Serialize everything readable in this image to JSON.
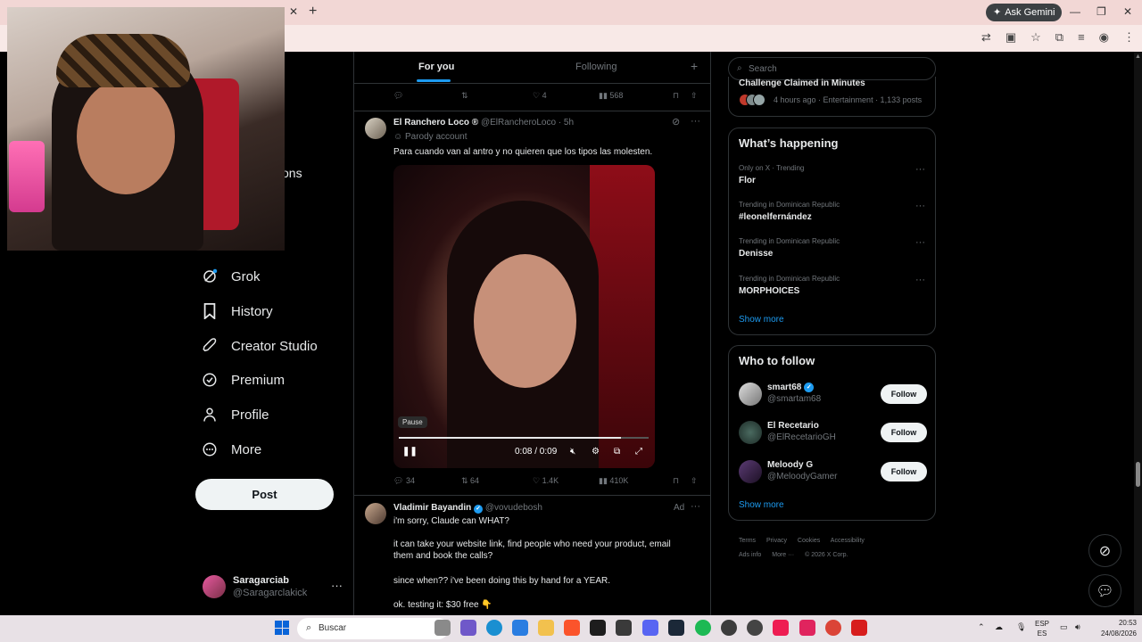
{
  "browser": {
    "ask_gemini": "Ask Gemini"
  },
  "nav": {
    "clipped_label": "ons",
    "items": [
      {
        "label": "Grok",
        "icon": "grok-icon"
      },
      {
        "label": "History",
        "icon": "bookmark-icon"
      },
      {
        "label": "Creator Studio",
        "icon": "rocket-icon"
      },
      {
        "label": "Premium",
        "icon": "verified-badge-icon"
      },
      {
        "label": "Profile",
        "icon": "person-icon"
      },
      {
        "label": "More",
        "icon": "more-circle-icon"
      }
    ],
    "post_label": "Post",
    "account": {
      "name": "Saragarciab",
      "handle": "@Saragarclakick"
    }
  },
  "timeline": {
    "tabs": [
      {
        "label": "For you",
        "active": true
      },
      {
        "label": "Following",
        "active": false
      }
    ],
    "prev_actions": {
      "likes": "4",
      "views": "568"
    },
    "tweet1": {
      "name": "El Ranchero Loco ®",
      "handle": "@ElRancheroLoco",
      "time": "· 5h",
      "sub": "Parody account",
      "text": "Para cuando van al antro y no quieren que los tipos las molesten.",
      "video": {
        "pause_tip": "Pause",
        "time": "0:08 / 0:09",
        "progress": 0.89
      },
      "actions": {
        "replies": "34",
        "reposts": "64",
        "likes": "1.4K",
        "views": "410K"
      }
    },
    "tweet2": {
      "name": "Vladimir Bayandin",
      "handle": "@vovudebosh",
      "ad": "Ad",
      "lines": [
        "i'm sorry, Claude can WHAT?",
        "it can take your website link, find people who need your product, email them and book the calls?",
        "since when?? i've been doing this by hand for a YEAR.",
        "ok. testing it: $30 free 👇"
      ]
    }
  },
  "right": {
    "search_placeholder": "Search",
    "top_trend": {
      "title": "Challenge Claimed in Minutes",
      "meta": "4 hours ago · Entertainment · 1,133 posts"
    },
    "whats_happening": {
      "title": "What’s happening",
      "trends": [
        {
          "context": "Only on X · Trending",
          "name": "Flor"
        },
        {
          "context": "Trending in Dominican Republic",
          "name": "#leonelfernández"
        },
        {
          "context": "Trending in Dominican Republic",
          "name": "Denisse"
        },
        {
          "context": "Trending in Dominican Republic",
          "name": "MORPHOICES"
        }
      ],
      "show_more": "Show more"
    },
    "who_to_follow": {
      "title": "Who to follow",
      "users": [
        {
          "name": "smart68",
          "handle": "@smartam68",
          "verified": true,
          "follow": "Follow"
        },
        {
          "name": "El Recetario",
          "handle": "@ElRecetarioGH",
          "verified": false,
          "follow": "Follow"
        },
        {
          "name": "Meloody G",
          "handle": "@MeloodyGamer",
          "verified": false,
          "follow": "Follow"
        }
      ],
      "show_more": "Show more"
    },
    "footer": {
      "terms": "Terms",
      "privacy": "Privacy",
      "cookies": "Cookies",
      "accessibility": "Accessibility",
      "ads_info": "Ads info",
      "more": "More ···",
      "copyright": "© 2026 X Corp."
    }
  },
  "taskbar": {
    "search_label": "Buscar",
    "lang": "ESP",
    "lang2": "ES",
    "time": "20:53",
    "date": "24/08/2026"
  }
}
